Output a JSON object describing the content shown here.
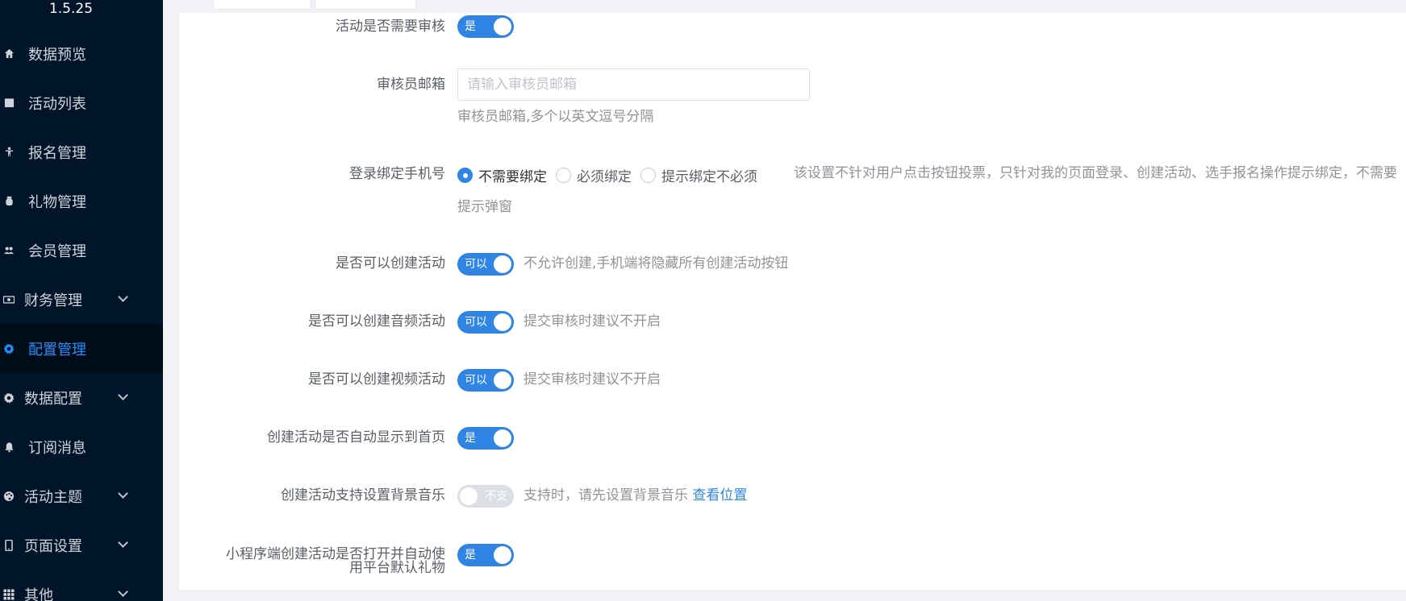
{
  "sidebar": {
    "version": "1.5.25",
    "items": [
      {
        "label": "数据预览",
        "icon": "home-icon",
        "has_arrow": false,
        "active": false
      },
      {
        "label": "活动列表",
        "icon": "calendar-icon",
        "has_arrow": false,
        "active": false
      },
      {
        "label": "报名管理",
        "icon": "person-icon",
        "has_arrow": false,
        "active": false
      },
      {
        "label": "礼物管理",
        "icon": "gift-icon",
        "has_arrow": false,
        "active": false
      },
      {
        "label": "会员管理",
        "icon": "users-icon",
        "has_arrow": false,
        "active": false
      },
      {
        "label": "财务管理",
        "icon": "money-icon",
        "has_arrow": true,
        "active": false
      },
      {
        "label": "配置管理",
        "icon": "gear-icon",
        "has_arrow": false,
        "active": true
      },
      {
        "label": "数据配置",
        "icon": "gear-icon",
        "has_arrow": true,
        "active": false
      },
      {
        "label": "订阅消息",
        "icon": "bell-icon",
        "has_arrow": false,
        "active": false
      },
      {
        "label": "活动主题",
        "icon": "palette-icon",
        "has_arrow": true,
        "active": false
      },
      {
        "label": "页面设置",
        "icon": "phone-icon",
        "has_arrow": true,
        "active": false
      },
      {
        "label": "其他",
        "icon": "grid-icon",
        "has_arrow": true,
        "active": false
      }
    ]
  },
  "form": {
    "audit": {
      "label": "活动是否需要审核",
      "switch_text": "是",
      "on": true
    },
    "auditor_email": {
      "label": "审核员邮箱",
      "placeholder": "请输入审核员邮箱",
      "value": "",
      "hint": "审核员邮箱,多个以英文逗号分隔"
    },
    "bind_phone": {
      "label": "登录绑定手机号",
      "options": [
        "不需要绑定",
        "必须绑定",
        "提示绑定不必须"
      ],
      "selected": "不需要绑定",
      "hint_line1": "该设置不针对用户点击按钮投票，只针对我的页面登录、创建活动、选手报名操作提示绑定，不需要",
      "hint_line2": "提示弹窗"
    },
    "can_create": {
      "label": "是否可以创建活动",
      "switch_text": "可以",
      "on": true,
      "hint": "不允许创建,手机端将隐藏所有创建活动按钮"
    },
    "can_create_audio": {
      "label": "是否可以创建音频活动",
      "switch_text": "可以",
      "on": true,
      "hint": "提交审核时建议不开启"
    },
    "can_create_video": {
      "label": "是否可以创建视频活动",
      "switch_text": "可以",
      "on": true,
      "hint": "提交审核时建议不开启"
    },
    "auto_home": {
      "label": "创建活动是否自动显示到首页",
      "switch_text": "是",
      "on": true
    },
    "bg_music": {
      "label": "创建活动支持设置背景音乐",
      "switch_text": "不支",
      "on": false,
      "hint": "支持时，请先设置背景音乐",
      "link": "查看位置"
    },
    "default_gift": {
      "label_line1": "小程序端创建活动是否打开并自动使",
      "label_line2": "用平台默认礼物",
      "switch_text": "是",
      "on": true
    }
  }
}
